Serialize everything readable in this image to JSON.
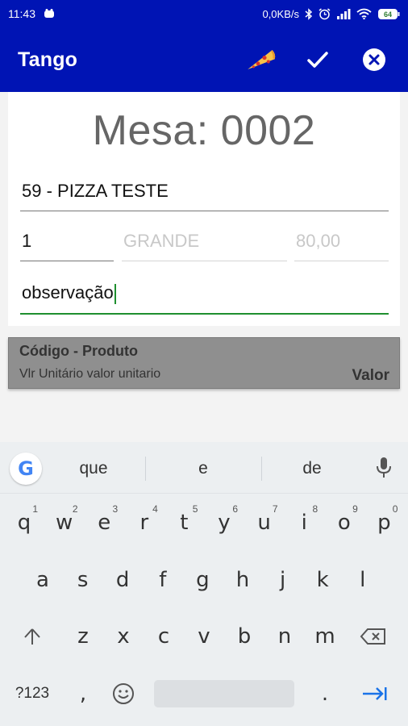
{
  "status_bar": {
    "time": "11:43",
    "speed": "0,0KB/s",
    "battery": "64",
    "icons": [
      "notification-app-icon",
      "bluetooth-icon",
      "alarm-icon",
      "signal-icon",
      "wifi-icon",
      "battery-icon"
    ]
  },
  "app_bar": {
    "title": "Tango",
    "actions": [
      "pizza-icon",
      "check-icon",
      "close-circle-icon"
    ],
    "color": "#0014b4"
  },
  "form": {
    "mesa": "Mesa: 0002",
    "product": "59 - PIZZA TESTE",
    "quantity": "1",
    "size": "GRANDE",
    "price": "80,00",
    "observation": "observação",
    "active_color": "#1f8f2f"
  },
  "list_header": {
    "title": "Código - Produto",
    "subtitle": "Vlr Unitário  valor unitario",
    "value_label": "Valor"
  },
  "keyboard": {
    "suggestions": [
      "que",
      "e",
      "de"
    ],
    "row1": [
      {
        "k": "q",
        "n": "1"
      },
      {
        "k": "w",
        "n": "2"
      },
      {
        "k": "e",
        "n": "3"
      },
      {
        "k": "r",
        "n": "4"
      },
      {
        "k": "t",
        "n": "5"
      },
      {
        "k": "y",
        "n": "6"
      },
      {
        "k": "u",
        "n": "7"
      },
      {
        "k": "i",
        "n": "8"
      },
      {
        "k": "o",
        "n": "9"
      },
      {
        "k": "p",
        "n": "0"
      }
    ],
    "row2": [
      "a",
      "s",
      "d",
      "f",
      "g",
      "h",
      "j",
      "k",
      "l"
    ],
    "row3": [
      "z",
      "x",
      "c",
      "v",
      "b",
      "n",
      "m"
    ],
    "symbols_label": "?123",
    "comma": ",",
    "period": "."
  }
}
